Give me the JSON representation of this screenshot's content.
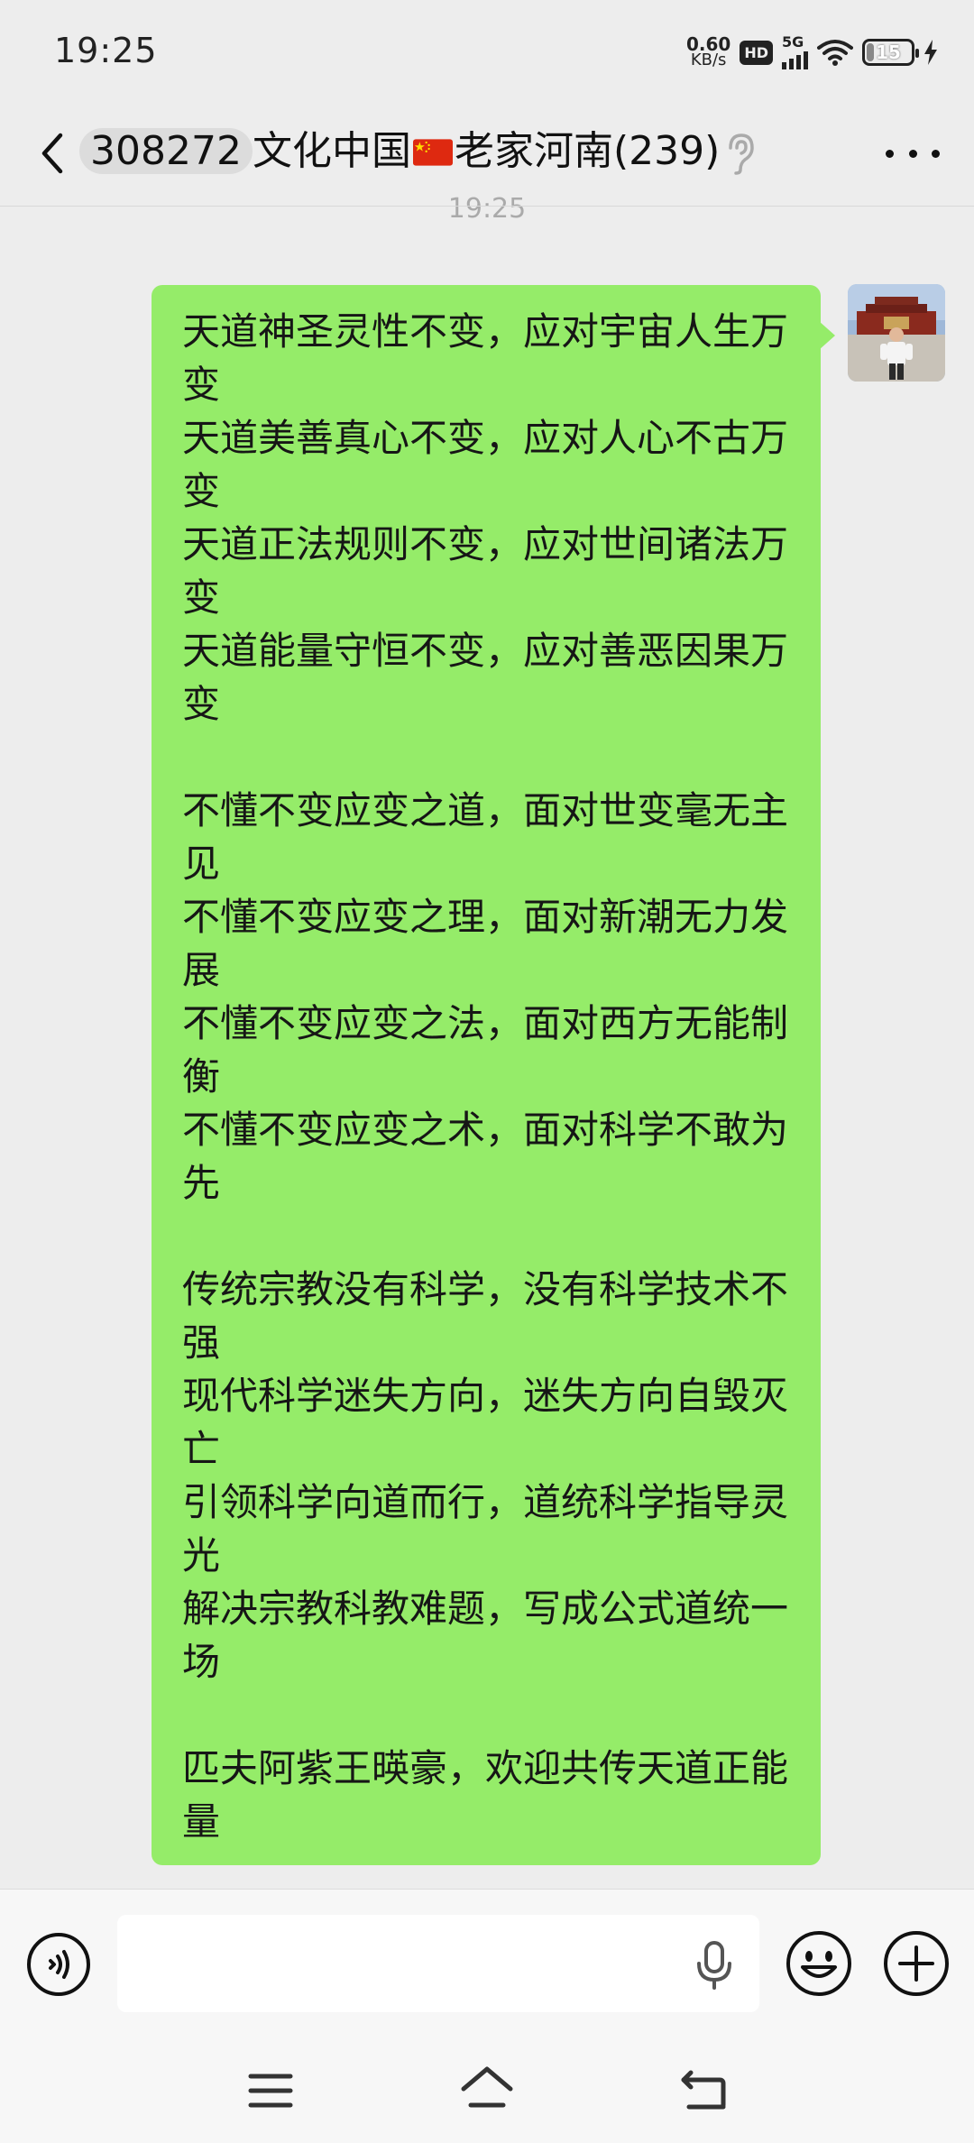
{
  "status_bar": {
    "time": "19:25",
    "net_speed_value": "0.60",
    "net_speed_unit": "KB/s",
    "hd_badge": "HD",
    "signal_type": "5G",
    "battery_level": "15"
  },
  "header": {
    "group_id": "308272",
    "title_part1": "文化中国",
    "title_part2": "老家河南(239)",
    "icons": [
      "back-arrow-icon",
      "china-flag-icon",
      "ear-icon",
      "more-icon"
    ]
  },
  "chat": {
    "timestamp": "19:25",
    "messages": [
      {
        "from": "self",
        "text": "天道神圣灵性不变，应对宇宙人生万变\n天道美善真心不变，应对人心不古万变\n天道正法规则不变，应对世间诸法万变\n天道能量守恒不变，应对善恶因果万变\n\n不懂不变应变之道，面对世变毫无主见\n不懂不变应变之理，面对新潮无力发展\n不懂不变应变之法，面对西方无能制衡\n不懂不变应变之术，面对科学不敢为先\n\n传统宗教没有科学，没有科学技术不强\n现代科学迷失方向，迷失方向自毁灭亡\n引领科学向道而行，道统科学指导灵光\n解决宗教科教难题，写成公式道统一场\n\n匹夫阿紫王暎豪，欢迎共传天道正能量"
      }
    ]
  },
  "input_bar": {
    "placeholder": "",
    "icons": [
      "voice-icon",
      "mic-icon",
      "emoji-icon",
      "plus-icon"
    ]
  },
  "nav_bar": {
    "icons": [
      "menu-icon",
      "home-icon",
      "back-icon"
    ]
  },
  "colors": {
    "background": "#ededed",
    "bubble_self": "#95ec69",
    "input_bar": "#f7f7f7"
  }
}
